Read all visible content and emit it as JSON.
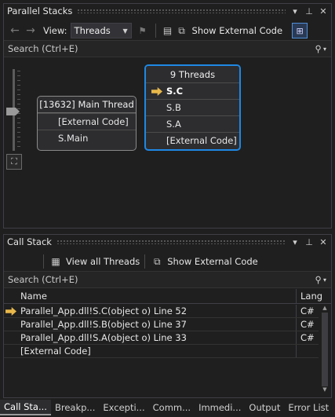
{
  "parallel_stacks": {
    "title": "Parallel Stacks",
    "window_icons": [
      "dropdown-icon",
      "pin-icon",
      "close-icon"
    ],
    "toolbar": {
      "view_label": "View:",
      "view_selected": "Threads",
      "show_external_code": "Show External Code"
    },
    "search": {
      "placeholder": "Search (Ctrl+E)"
    },
    "main_thread_node": {
      "header": "[13632] Main Thread",
      "frames": [
        "[External Code]",
        "S.Main"
      ]
    },
    "threads_node": {
      "header": "9 Threads",
      "frames": [
        "S.C",
        "S.B",
        "S.A",
        "[External Code]"
      ],
      "current_frame_index": 0
    }
  },
  "call_stack": {
    "title": "Call Stack",
    "toolbar": {
      "view_all_threads": "View all Threads",
      "show_external_code": "Show External Code"
    },
    "search": {
      "placeholder": "Search (Ctrl+E)"
    },
    "columns": [
      "Name",
      "Lang"
    ],
    "rows": [
      {
        "name": "Parallel_App.dll!S.C(object o) Line 52",
        "lang": "C#",
        "current": true
      },
      {
        "name": "Parallel_App.dll!S.B(object o) Line 37",
        "lang": "C#",
        "current": false
      },
      {
        "name": "Parallel_App.dll!S.A(object o) Line 33",
        "lang": "C#",
        "current": false
      },
      {
        "name": "[External Code]",
        "lang": "",
        "current": false
      }
    ]
  },
  "bottom_tabs": [
    "Call Sta...",
    "Breakp...",
    "Excepti...",
    "Comm...",
    "Immedi...",
    "Output",
    "Error List"
  ],
  "colors": {
    "accent": "#1e88e5",
    "current_frame_arrow": "#e8b84a",
    "background": "#1f1f1f"
  }
}
